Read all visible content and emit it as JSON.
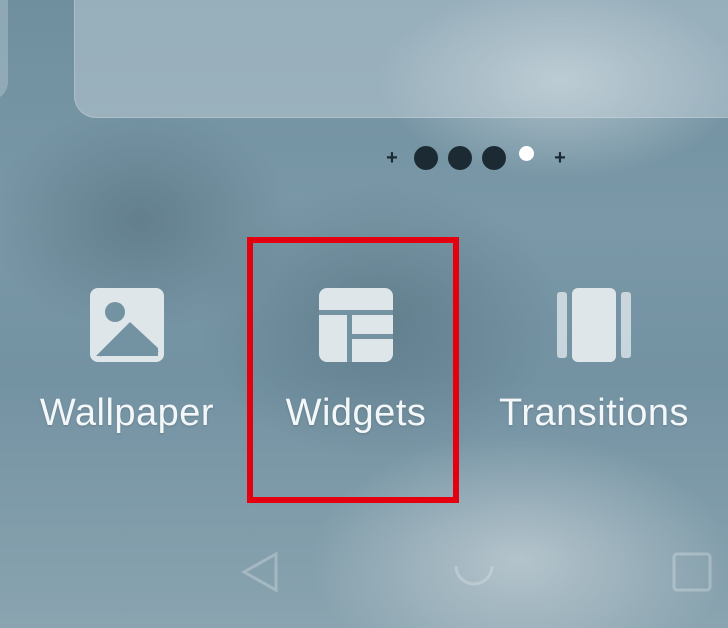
{
  "pager": {
    "items": [
      "add",
      "page",
      "page",
      "page",
      "current",
      "add"
    ],
    "current_index": 4
  },
  "menu": {
    "items": [
      {
        "label": "Wallpaper",
        "icon": "image-icon"
      },
      {
        "label": "Widgets",
        "icon": "widgets-icon"
      },
      {
        "label": "Transitions",
        "icon": "transitions-icon"
      }
    ],
    "highlighted": "Widgets"
  },
  "navbar": {
    "buttons": [
      "back-icon",
      "home-icon",
      "recents-icon"
    ]
  },
  "colors": {
    "highlight": "#e4000f",
    "label": "#f3f7f9",
    "icon_fill": "#dfe6ea"
  }
}
